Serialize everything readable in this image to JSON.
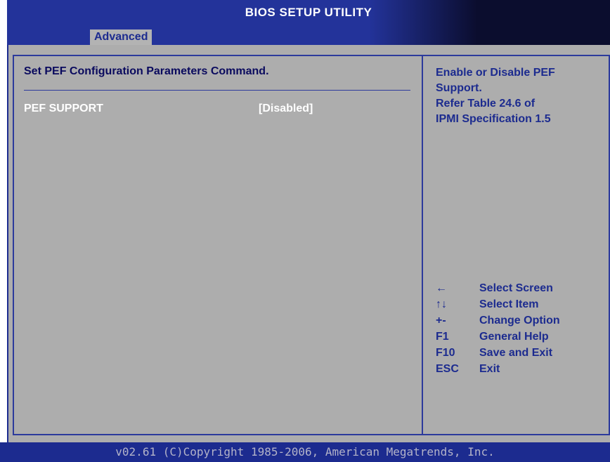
{
  "window": {
    "title": "BIOS SETUP UTILITY"
  },
  "tabs": [
    {
      "label": "Advanced",
      "active": true
    }
  ],
  "main": {
    "heading": "Set PEF Configuration Parameters Command.",
    "options": [
      {
        "label": "PEF SUPPORT",
        "value": "[Disabled]"
      }
    ]
  },
  "help": {
    "lines": [
      "Enable or Disable PEF",
      "Support.",
      "Refer Table 24.6 of",
      "IPMI Specification 1.5"
    ]
  },
  "keys": [
    {
      "key": "←",
      "desc": "Select Screen"
    },
    {
      "key": "↑↓",
      "desc": "Select Item"
    },
    {
      "key": "+-",
      "desc": "Change Option"
    },
    {
      "key": "F1",
      "desc": "General Help"
    },
    {
      "key": "F10",
      "desc": "Save and Exit"
    },
    {
      "key": "ESC",
      "desc": "Exit"
    }
  ],
  "footer": {
    "text": "v02.61 (C)Copyright 1985-2006, American Megatrends, Inc."
  },
  "colors": {
    "background": "#adadad",
    "frame": "#1c2b8f",
    "highlight": "#ffffff"
  }
}
